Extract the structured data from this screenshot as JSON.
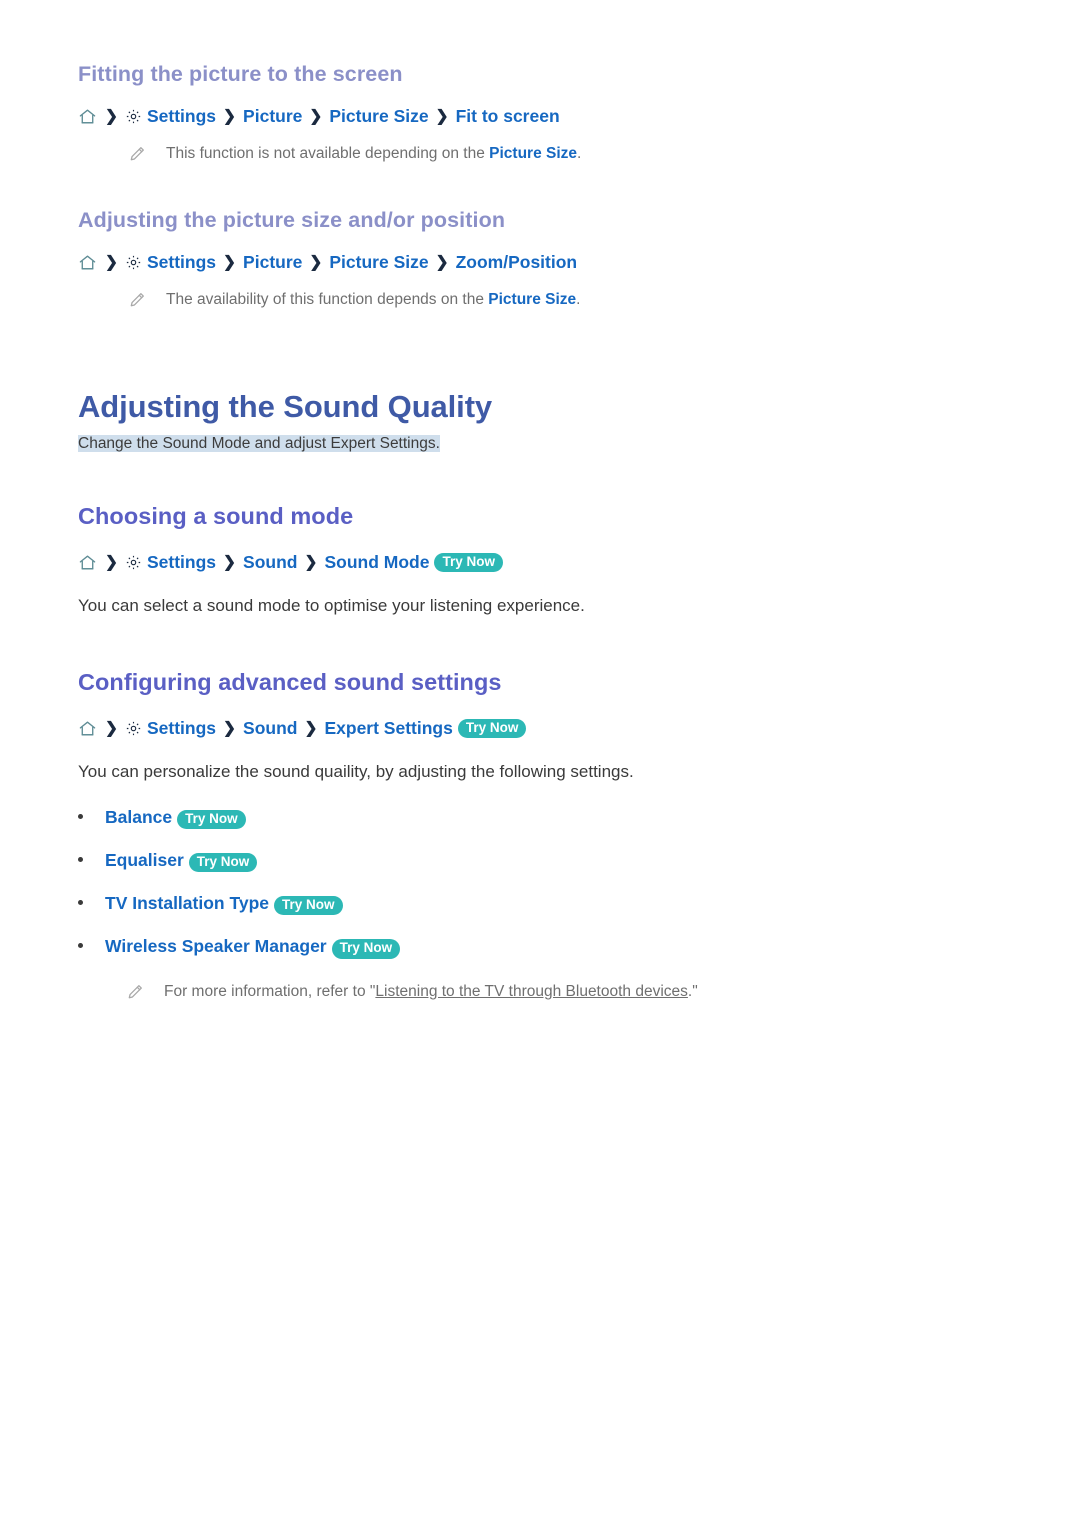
{
  "sections": [
    {
      "heading": "Fitting the picture to the screen",
      "breadcrumb": [
        "Settings",
        "Picture",
        "Picture Size",
        "Fit to screen"
      ],
      "note": {
        "before": "This function is not available depending on the ",
        "link": "Picture Size",
        "after": "."
      }
    },
    {
      "heading": "Adjusting the picture size and/or position",
      "breadcrumb": [
        "Settings",
        "Picture",
        "Picture Size",
        "Zoom/Position"
      ],
      "note": {
        "before": "The availability of this function depends on the ",
        "link": "Picture Size",
        "after": "."
      }
    }
  ],
  "main": {
    "title": "Adjusting the Sound Quality",
    "subtitle": "Change the Sound Mode and adjust Expert Settings."
  },
  "sound_mode": {
    "heading": "Choosing a sound mode",
    "breadcrumb": [
      "Settings",
      "Sound",
      "Sound Mode"
    ],
    "badge": "Try Now",
    "paragraph": "You can select a sound mode to optimise your listening experience."
  },
  "advanced": {
    "heading": "Configuring advanced sound settings",
    "breadcrumb": [
      "Settings",
      "Sound",
      "Expert Settings"
    ],
    "badge": "Try Now",
    "paragraph": "You can personalize the sound quaility, by adjusting the following settings.",
    "items": [
      {
        "label": "Balance",
        "badge": "Try Now"
      },
      {
        "label": "Equaliser",
        "badge": "Try Now"
      },
      {
        "label": "TV Installation Type",
        "badge": "Try Now"
      },
      {
        "label": "Wireless Speaker Manager",
        "badge": "Try Now"
      }
    ],
    "note": {
      "before": "For more information, refer to \"",
      "link": "Listening to the TV through Bluetooth devices",
      "after": ".\""
    }
  },
  "icons": {
    "home": "home-icon",
    "gear": "gear-icon",
    "separator": "chevron-right-icon",
    "pencil": "pencil-note-icon"
  },
  "colors": {
    "h1": "#3f5aa6",
    "h2": "#5a5fc4",
    "h3": "#8b90c8",
    "link": "#1668c1",
    "badge": "#2cb8b5",
    "highlight": "#cfdeec",
    "body": "#3a3a3a",
    "note": "#6f6f6f"
  }
}
